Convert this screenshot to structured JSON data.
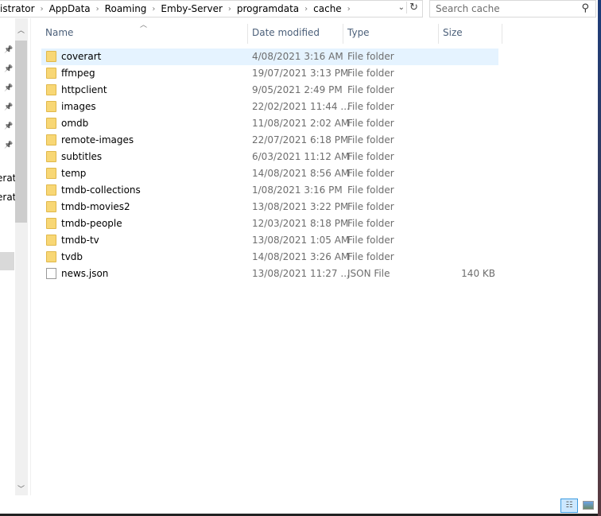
{
  "address": {
    "crumbs": [
      "istrator",
      "AppData",
      "Roaming",
      "Emby-Server",
      "programdata",
      "cache"
    ]
  },
  "search": {
    "placeholder": "Search cache"
  },
  "nav": {
    "truncated_items": [
      "erat",
      "erat"
    ]
  },
  "columns": {
    "name": "Name",
    "date": "Date modified",
    "type": "Type",
    "size": "Size"
  },
  "files": [
    {
      "name": "coverart",
      "date": "4/08/2021 3:16 AM",
      "type": "File folder",
      "size": "",
      "kind": "folder"
    },
    {
      "name": "ffmpeg",
      "date": "19/07/2021 3:13 PM",
      "type": "File folder",
      "size": "",
      "kind": "folder"
    },
    {
      "name": "httpclient",
      "date": "9/05/2021 2:49 PM",
      "type": "File folder",
      "size": "",
      "kind": "folder"
    },
    {
      "name": "images",
      "date": "22/02/2021 11:44 ...",
      "type": "File folder",
      "size": "",
      "kind": "folder"
    },
    {
      "name": "omdb",
      "date": "11/08/2021 2:02 AM",
      "type": "File folder",
      "size": "",
      "kind": "folder"
    },
    {
      "name": "remote-images",
      "date": "22/07/2021 6:18 PM",
      "type": "File folder",
      "size": "",
      "kind": "folder"
    },
    {
      "name": "subtitles",
      "date": "6/03/2021 11:12 AM",
      "type": "File folder",
      "size": "",
      "kind": "folder"
    },
    {
      "name": "temp",
      "date": "14/08/2021 8:56 AM",
      "type": "File folder",
      "size": "",
      "kind": "folder"
    },
    {
      "name": "tmdb-collections",
      "date": "1/08/2021 3:16 PM",
      "type": "File folder",
      "size": "",
      "kind": "folder"
    },
    {
      "name": "tmdb-movies2",
      "date": "13/08/2021 3:22 PM",
      "type": "File folder",
      "size": "",
      "kind": "folder"
    },
    {
      "name": "tmdb-people",
      "date": "12/03/2021 8:18 PM",
      "type": "File folder",
      "size": "",
      "kind": "folder"
    },
    {
      "name": "tmdb-tv",
      "date": "13/08/2021 1:05 AM",
      "type": "File folder",
      "size": "",
      "kind": "folder"
    },
    {
      "name": "tvdb",
      "date": "14/08/2021 3:26 AM",
      "type": "File folder",
      "size": "",
      "kind": "folder"
    },
    {
      "name": "news.json",
      "date": "13/08/2021 11:27 ...",
      "type": "JSON File",
      "size": "140 KB",
      "kind": "file"
    }
  ]
}
